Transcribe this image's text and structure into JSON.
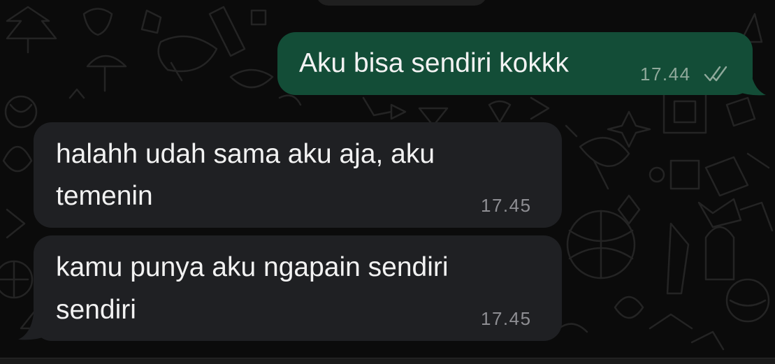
{
  "colors": {
    "background": "#0b0b0b",
    "outgoing_bubble": "#134d37",
    "incoming_bubble": "#1f2023",
    "text": "#f2f2f2",
    "outgoing_time": "#8fa99b",
    "incoming_time": "#8e8e93",
    "read_ticks": "#8fa99b"
  },
  "messages": [
    {
      "direction": "outgoing",
      "lines": [
        "Aku bisa sendiri kokkk"
      ],
      "time": "17.44",
      "status_icon": "double-check-icon"
    },
    {
      "direction": "incoming",
      "lines": [
        "halahh udah sama aku aja, aku",
        "temenin"
      ],
      "time": "17.45"
    },
    {
      "direction": "incoming",
      "lines": [
        "kamu punya aku ngapain sendiri",
        "sendiri"
      ],
      "time": "17.45"
    }
  ]
}
